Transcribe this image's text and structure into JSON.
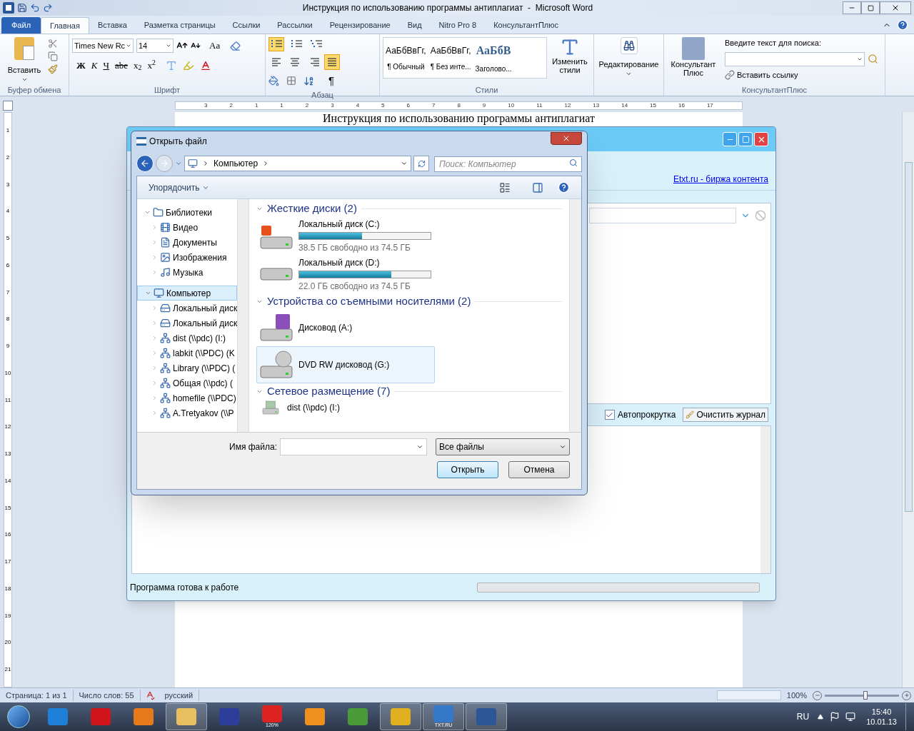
{
  "word": {
    "title": "Инструкция по использованию программы антиплагиат  -  Microsoft Word",
    "tabs": [
      {
        "label": "Файл",
        "kind": "file",
        "selected": false
      },
      {
        "label": "Главная",
        "kind": "tab",
        "selected": true
      },
      {
        "label": "Вставка",
        "kind": "tab",
        "selected": false
      },
      {
        "label": "Разметка страницы",
        "kind": "tab",
        "selected": false
      },
      {
        "label": "Ссылки",
        "kind": "tab",
        "selected": false
      },
      {
        "label": "Рассылки",
        "kind": "tab",
        "selected": false
      },
      {
        "label": "Рецензирование",
        "kind": "tab",
        "selected": false
      },
      {
        "label": "Вид",
        "kind": "tab",
        "selected": false
      },
      {
        "label": "Nitro Pro 8",
        "kind": "tab",
        "selected": false
      },
      {
        "label": "КонсультантПлюс",
        "kind": "tab",
        "selected": false
      }
    ]
  },
  "ribbon": {
    "clipboard": {
      "paste": "Вставить",
      "label": "Буфер обмена"
    },
    "font": {
      "name": "Times New Rc",
      "size": "14",
      "case": "Aa",
      "styles": [
        "Ж",
        "К",
        "Ч",
        "abe",
        "x$_{2}$",
        "x$^{2}$"
      ],
      "label": "Шрифт"
    },
    "paragraph": {
      "lists": [
        {
          "kind": "bullets",
          "selected": true
        },
        {
          "kind": "numbers",
          "selected": false
        },
        {
          "kind": "multilevel",
          "selected": false
        }
      ],
      "align": [
        {
          "kind": "left",
          "selected": false
        },
        {
          "kind": "center",
          "selected": false
        },
        {
          "kind": "right",
          "selected": false
        },
        {
          "kind": "justify",
          "selected": true
        }
      ],
      "pilcrow": "¶",
      "label": "Абзац"
    },
    "styles": {
      "items": [
        {
          "sample": "АаБбВвГг,",
          "name": "¶ Обычный",
          "kind": "body"
        },
        {
          "sample": "АаБбВвГг,",
          "name": "¶ Без инте...",
          "kind": "body"
        },
        {
          "sample": "АаБбВ",
          "name": "Заголово...",
          "kind": "heading"
        }
      ],
      "change": "Изменить стили",
      "label": "Стили"
    },
    "editing": "Редактирование",
    "consultant": {
      "button": "Консультант Плюс",
      "search_label": "Введите текст для поиска:",
      "insert_link": "Вставить ссылку",
      "label": "КонсультантПлюс"
    }
  },
  "ruler": {
    "horizontal": [
      "3",
      "2",
      "1",
      "1",
      "2",
      "3",
      "4",
      "5",
      "6",
      "7",
      "8",
      "9",
      "10",
      "11",
      "12",
      "13",
      "14",
      "15",
      "16",
      "17"
    ],
    "vertical": [
      "1",
      "2",
      "3",
      "4",
      "5",
      "6",
      "7",
      "8",
      "9",
      "10",
      "11",
      "12",
      "13",
      "14",
      "15",
      "16",
      "17",
      "18",
      "19",
      "20",
      "21"
    ]
  },
  "document": {
    "heading": "Инструкция по использованию программы антиплагиат"
  },
  "status_bar": {
    "page": "Страница: 1 из 1",
    "words": "Число слов: 55",
    "language": "русский",
    "zoom": "100%",
    "zoom_slider": {
      "level": 0.55
    }
  },
  "app_window": {
    "link": "Etxt.ru - биржа контента",
    "autoscroll": {
      "label": "Автопрокрутка",
      "checked": true
    },
    "clear_button": "Очистить журнал",
    "status": "Программа готова к работе",
    "progress": {
      "level": 0
    }
  },
  "dialog": {
    "title": "Открыть файл",
    "breadcrumb": "Компьютер",
    "search_placeholder": "Поиск: Компьютер",
    "organize": "Упорядочить",
    "tree": [
      {
        "label": "Библиотеки",
        "kind": "library",
        "expanded": true,
        "selected": false,
        "children": [
          {
            "label": "Видео",
            "kind": "video",
            "expanded": false,
            "selected": false
          },
          {
            "label": "Документы",
            "kind": "docs",
            "expanded": false,
            "selected": false
          },
          {
            "label": "Изображения",
            "kind": "images",
            "expanded": false,
            "selected": false
          },
          {
            "label": "Музыка",
            "kind": "music",
            "expanded": false,
            "selected": false
          }
        ]
      },
      {
        "label": "Компьютер",
        "kind": "computer",
        "expanded": true,
        "selected": true,
        "children": [
          {
            "label": "Локальный диск",
            "kind": "system-drive",
            "expanded": false,
            "selected": false
          },
          {
            "label": "Локальный диск",
            "kind": "drive",
            "expanded": false,
            "selected": false
          },
          {
            "label": "dist (\\\\pdc) (I:)",
            "kind": "network",
            "expanded": false,
            "selected": false
          },
          {
            "label": "labkit (\\\\PDC) (K",
            "kind": "network",
            "expanded": false,
            "selected": false
          },
          {
            "label": "Library (\\\\PDC) (",
            "kind": "network",
            "expanded": false,
            "selected": false
          },
          {
            "label": "Общая (\\\\pdc) (",
            "kind": "network",
            "expanded": false,
            "selected": false
          },
          {
            "label": "homefile (\\\\PDC)",
            "kind": "network",
            "expanded": false,
            "selected": false
          },
          {
            "label": "A.Tretyakov (\\\\P",
            "kind": "network",
            "expanded": false,
            "selected": false
          }
        ]
      }
    ],
    "groups": [
      {
        "title": "Жесткие диски (2)",
        "items": [
          {
            "name": "Локальный диск (C:)",
            "kind": "system-disk",
            "level": 0.48,
            "free": "38.5 ГБ свободно из 74.5 ГБ",
            "selected": false
          },
          {
            "name": "Локальный диск (D:)",
            "kind": "disk",
            "level": 0.7,
            "free": "22.0 ГБ свободно из 74.5 ГБ",
            "selected": false
          }
        ]
      },
      {
        "title": "Устройства со съемными носителями (2)",
        "items": [
          {
            "name": "Дисковод (A:)",
            "kind": "floppy",
            "selected": false
          },
          {
            "name": "DVD RW дисковод (G:)",
            "kind": "dvd",
            "selected": true
          }
        ]
      },
      {
        "title": "Сетевое размещение (7)",
        "items": [
          {
            "name": "dist (\\\\pdc) (I:)",
            "kind": "network",
            "selected": false
          }
        ]
      }
    ],
    "filename_label": "Имя файла:",
    "filter": "Все файлы",
    "open": "Открыть",
    "cancel": "Отмена"
  },
  "taskbar": {
    "apps": [
      {
        "kind": "ie",
        "active": false
      },
      {
        "kind": "opera",
        "active": false
      },
      {
        "kind": "firefox",
        "active": false
      },
      {
        "kind": "explorer",
        "active": true
      },
      {
        "kind": "floppy",
        "active": false
      },
      {
        "kind": "reader",
        "badge": "120%",
        "active": false
      },
      {
        "kind": "media",
        "active": false
      },
      {
        "kind": "chrome",
        "active": false
      },
      {
        "kind": "tool",
        "active": true
      },
      {
        "kind": "txt",
        "badge": "TXT.RU",
        "active": true
      },
      {
        "kind": "word",
        "active": true
      }
    ],
    "language": "RU",
    "time": "15:40",
    "date": "10.01.13"
  }
}
